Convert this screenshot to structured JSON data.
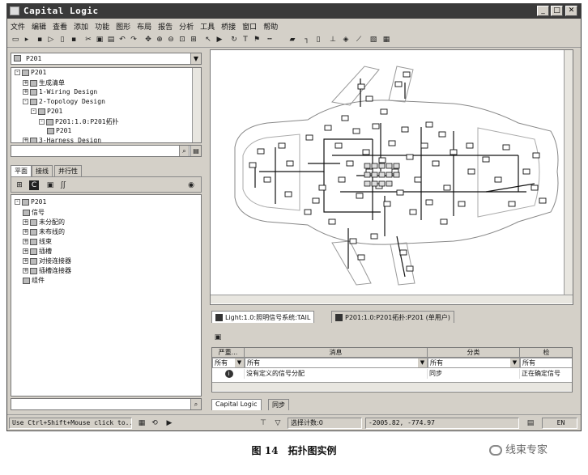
{
  "window": {
    "title": "Capital Logic",
    "controls": [
      "_",
      "□",
      "✕"
    ]
  },
  "menu": [
    "文件",
    "编辑",
    "查看",
    "添加",
    "功能",
    "图形",
    "布局",
    "报告",
    "分析",
    "工具",
    "桥接",
    "窗口",
    "帮助"
  ],
  "left_top": {
    "combo_value": "P201",
    "tree": [
      {
        "label": "P201",
        "indent": 0,
        "exp": "-"
      },
      {
        "label": "生成清单",
        "indent": 1,
        "exp": "+"
      },
      {
        "label": "1-Wiring Design",
        "indent": 1,
        "exp": "+"
      },
      {
        "label": "2-Topology Design",
        "indent": 1,
        "exp": "-"
      },
      {
        "label": "P201",
        "indent": 2,
        "exp": "-"
      },
      {
        "label": "P201:1.0:P201拓扑",
        "indent": 3,
        "exp": "-"
      },
      {
        "label": "P201",
        "indent": 4,
        "exp": ""
      },
      {
        "label": "3-Harness Design",
        "indent": 1,
        "exp": "+"
      }
    ]
  },
  "left_tabs": [
    "平面",
    "接线",
    "并行性"
  ],
  "left_bottom": {
    "tree": [
      {
        "label": "P201",
        "indent": 0,
        "exp": "-"
      },
      {
        "label": "信号",
        "indent": 1,
        "exp": ""
      },
      {
        "label": "未分配的",
        "indent": 1,
        "exp": "+"
      },
      {
        "label": "未布线的",
        "indent": 1,
        "exp": "+"
      },
      {
        "label": "线束",
        "indent": 1,
        "exp": "+"
      },
      {
        "label": "插槽",
        "indent": 1,
        "exp": "+"
      },
      {
        "label": "对接连接器",
        "indent": 1,
        "exp": "+"
      },
      {
        "label": "插槽连接器",
        "indent": 1,
        "exp": "+"
      },
      {
        "label": "组件",
        "indent": 1,
        "exp": ""
      }
    ]
  },
  "doc_tabs": [
    "Light:1.0:照明信号系统:TAIL",
    "P201:1.0:P201拓扑:P201  (单用户)"
  ],
  "messages": {
    "headers": [
      "严重...",
      "消息",
      "分类",
      "检"
    ],
    "filters": [
      "所有",
      "所有",
      "所有",
      "所有"
    ],
    "rows": [
      {
        "severity": "i",
        "message": "没有定义的信号分配",
        "category": "同步",
        "check": "正在确定信号"
      }
    ]
  },
  "bottom_tabs": [
    "Capital Logic",
    "同步"
  ],
  "status": {
    "hint": "Use Ctrl+Shift+Mouse click to...",
    "selection": "选择计数:0",
    "coords": "-2005.82, -774.97",
    "mode": "EN"
  },
  "caption": {
    "fig": "图 14",
    "title": "拓扑图实例"
  },
  "watermark": "线束专家"
}
